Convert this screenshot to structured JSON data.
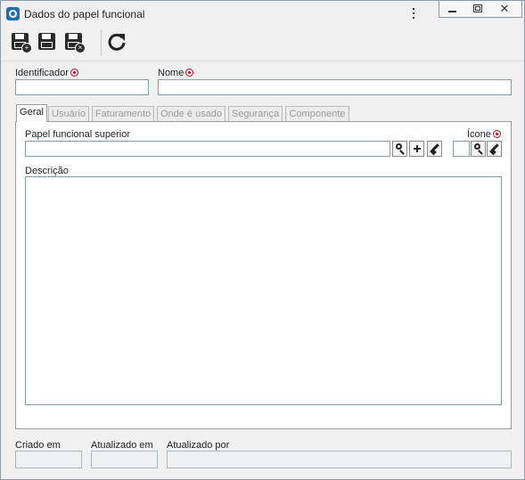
{
  "window": {
    "title": "Dados do papel funcional",
    "controls": {
      "close_glyph": "✕"
    }
  },
  "toolbar": {
    "buttons": [
      {
        "name": "save-and-new",
        "icon": "save-new-icon",
        "badge": "+"
      },
      {
        "name": "save",
        "icon": "save-icon"
      },
      {
        "name": "save-and-close",
        "icon": "save-close-icon",
        "badge": "×"
      },
      {
        "name": "refresh",
        "icon": "refresh-icon"
      }
    ]
  },
  "form": {
    "identificador_label": "Identificador",
    "identificador_value": "",
    "nome_label": "Nome",
    "nome_value": "",
    "required_color": "#d0021b"
  },
  "tabs": [
    {
      "label": "Geral",
      "active": true
    },
    {
      "label": "Usuário",
      "active": false
    },
    {
      "label": "Faturamento",
      "active": false
    },
    {
      "label": "Onde é usado",
      "active": false
    },
    {
      "label": "Segurança",
      "active": false
    },
    {
      "label": "Componente",
      "active": false
    }
  ],
  "geral": {
    "papel_superior_label": "Papel funcional superior",
    "papel_superior_value": "",
    "icone_label": "Ícone",
    "descricao_label": "Descrição",
    "descricao_value": ""
  },
  "footer": {
    "criado_em_label": "Criado em",
    "criado_em_value": "",
    "atualizado_em_label": "Atualizado em",
    "atualizado_em_value": "",
    "atualizado_por_label": "Atualizado por",
    "atualizado_por_value": ""
  },
  "colors": {
    "accent": "#1f6fb3",
    "field_border": "#7f9db9"
  }
}
